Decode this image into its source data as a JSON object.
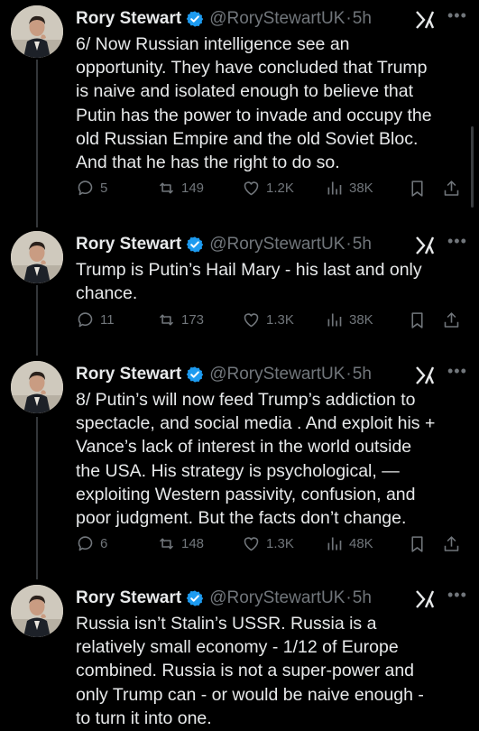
{
  "colors": {
    "background": "#000000",
    "text": "#e7e9ea",
    "muted": "#71767b",
    "verified": "#1d9bf0",
    "thread_line": "#333639"
  },
  "tweets": [
    {
      "name": "Rory Stewart",
      "handle": "@RoryStewartUK",
      "separator": "·",
      "time": "5h",
      "text": "6/ Now Russian intelligence see an\nopportunity. They have concluded that Trump\nis naive and isolated enough to believe that\nPutin has the power to invade and occupy the\nold Russian Empire and the old Soviet Bloc.\nAnd that he has the right to do so.",
      "replies": "5",
      "reposts": "149",
      "likes": "1.2K",
      "views": "38K"
    },
    {
      "name": "Rory Stewart",
      "handle": "@RoryStewartUK",
      "separator": "·",
      "time": "5h",
      "text": "Trump is Putin’s Hail Mary - his last and only\nchance.",
      "replies": "11",
      "reposts": "173",
      "likes": "1.3K",
      "views": "38K"
    },
    {
      "name": "Rory Stewart",
      "handle": "@RoryStewartUK",
      "separator": "·",
      "time": "5h",
      "text": "8/ Putin’s will now feed Trump’s addiction to\nspectacle, and social media . And exploit his +\nVance’s lack of interest in the world outside\nthe USA. His strategy is psychological, —\nexploiting Western passivity, confusion, and\npoor judgment. But the facts don’t change.",
      "replies": "6",
      "reposts": "148",
      "likes": "1.3K",
      "views": "48K"
    },
    {
      "name": "Rory Stewart",
      "handle": "@RoryStewartUK",
      "separator": "·",
      "time": "5h",
      "text": "Russia isn’t Stalin’s USSR. Russia is a\nrelatively small economy - 1/12 of Europe\ncombined. Russia is not a super-power and\nonly Trump can - or would be naive enough -\nto turn it into one.",
      "replies": "",
      "reposts": "",
      "likes": "",
      "views": ""
    }
  ]
}
